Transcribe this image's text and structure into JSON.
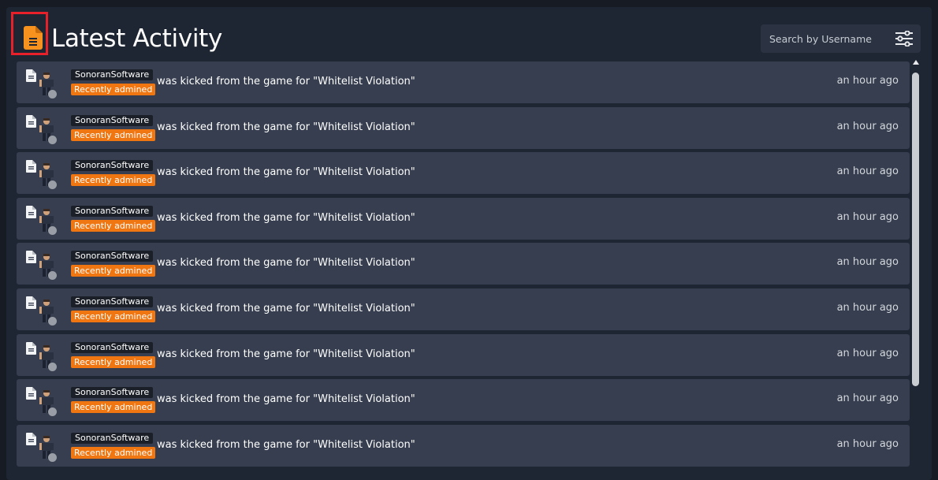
{
  "header": {
    "title": "Latest Activity",
    "title_icon": "document-icon",
    "title_icon_color": "#f7921e",
    "highlight_color": "#e8202a"
  },
  "search": {
    "placeholder": "Search by Username",
    "filter_icon": "sliders-icon"
  },
  "colors": {
    "background": "#161b24",
    "panel": "#1f2633",
    "row": "#363e4f",
    "badge": "#f07612",
    "username_chip": "#1b1f27"
  },
  "activity": [
    {
      "username": "SonoranSoftware",
      "badge": "Recently admined",
      "message": "was kicked from the game for \"Whitelist Violation\"",
      "time": "an hour ago",
      "status": "offline"
    },
    {
      "username": "SonoranSoftware",
      "badge": "Recently admined",
      "message": "was kicked from the game for \"Whitelist Violation\"",
      "time": "an hour ago",
      "status": "offline"
    },
    {
      "username": "SonoranSoftware",
      "badge": "Recently admined",
      "message": "was kicked from the game for \"Whitelist Violation\"",
      "time": "an hour ago",
      "status": "offline"
    },
    {
      "username": "SonoranSoftware",
      "badge": "Recently admined",
      "message": "was kicked from the game for \"Whitelist Violation\"",
      "time": "an hour ago",
      "status": "offline"
    },
    {
      "username": "SonoranSoftware",
      "badge": "Recently admined",
      "message": "was kicked from the game for \"Whitelist Violation\"",
      "time": "an hour ago",
      "status": "offline"
    },
    {
      "username": "SonoranSoftware",
      "badge": "Recently admined",
      "message": "was kicked from the game for \"Whitelist Violation\"",
      "time": "an hour ago",
      "status": "offline"
    },
    {
      "username": "SonoranSoftware",
      "badge": "Recently admined",
      "message": "was kicked from the game for \"Whitelist Violation\"",
      "time": "an hour ago",
      "status": "offline"
    },
    {
      "username": "SonoranSoftware",
      "badge": "Recently admined",
      "message": "was kicked from the game for \"Whitelist Violation\"",
      "time": "an hour ago",
      "status": "offline"
    },
    {
      "username": "SonoranSoftware",
      "badge": "Recently admined",
      "message": "was kicked from the game for \"Whitelist Violation\"",
      "time": "an hour ago",
      "status": "offline"
    }
  ]
}
